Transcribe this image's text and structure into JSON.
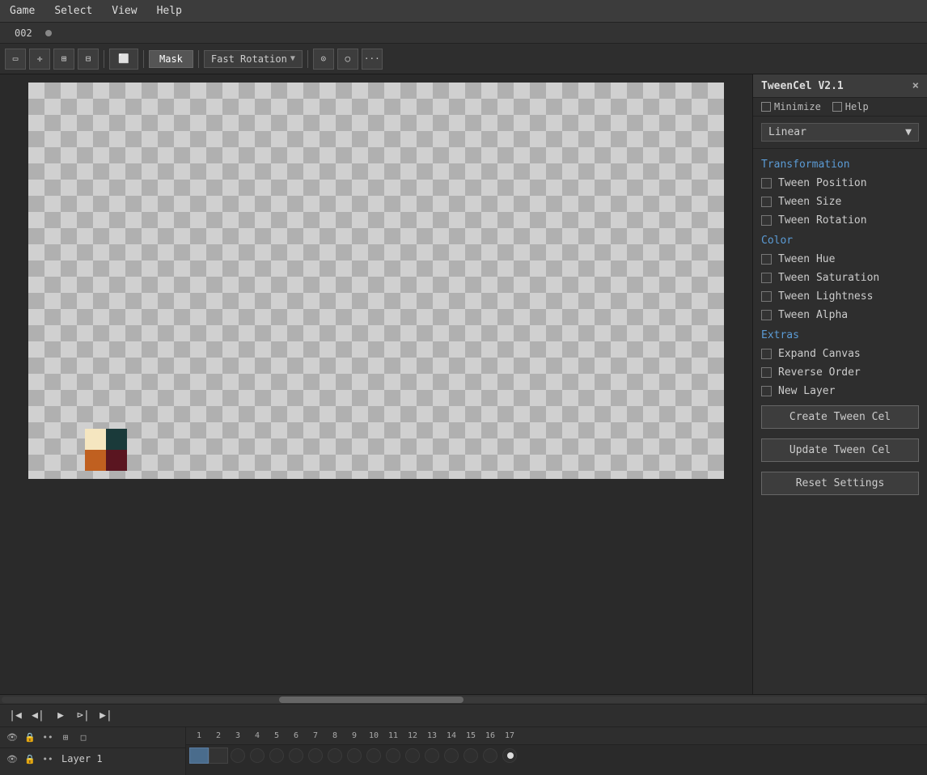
{
  "menubar": {
    "items": [
      "Game",
      "Select",
      "View",
      "Help"
    ]
  },
  "tabbar": {
    "label": "002"
  },
  "toolbar": {
    "mask_label": "Mask",
    "rotation_label": "Fast Rotation",
    "buttons": [
      "rect-select",
      "move",
      "transform",
      "grid"
    ],
    "extra_icons": [
      "camera",
      "circle",
      "dots"
    ]
  },
  "panel": {
    "title": "TweenCel V2.1",
    "close_btn": "×",
    "minimize_label": "Minimize",
    "help_label": "Help",
    "dropdown_value": "Linear",
    "sections": {
      "transformation": {
        "header": "Transformation",
        "items": [
          {
            "label": "Tween Position",
            "checked": false
          },
          {
            "label": "Tween Size",
            "checked": false
          },
          {
            "label": "Tween Rotation",
            "checked": false
          }
        ]
      },
      "color": {
        "header": "Color",
        "items": [
          {
            "label": "Tween Hue",
            "checked": false
          },
          {
            "label": "Tween Saturation",
            "checked": false
          },
          {
            "label": "Tween Lightness",
            "checked": false
          },
          {
            "label": "Tween Alpha",
            "checked": false
          }
        ]
      },
      "extras": {
        "header": "Extras",
        "items": [
          {
            "label": "Expand Canvas",
            "checked": false
          },
          {
            "label": "Reverse Order",
            "checked": false
          },
          {
            "label": "New Layer",
            "checked": false
          }
        ]
      }
    },
    "buttons": {
      "create": "Create Tween Cel",
      "update": "Update Tween Cel",
      "reset": "Reset Settings"
    }
  },
  "timeline": {
    "layer_name": "Layer 1",
    "frame_numbers": [
      1,
      2,
      3,
      4,
      5,
      6,
      7,
      8,
      9,
      10,
      11,
      12,
      13,
      14,
      15,
      16,
      17
    ]
  },
  "colors": {
    "accent_blue": "#5b9bd5",
    "bg_dark": "#2a2a2a",
    "bg_panel": "#2e2e2e",
    "bg_toolbar": "#3c3c3c"
  }
}
